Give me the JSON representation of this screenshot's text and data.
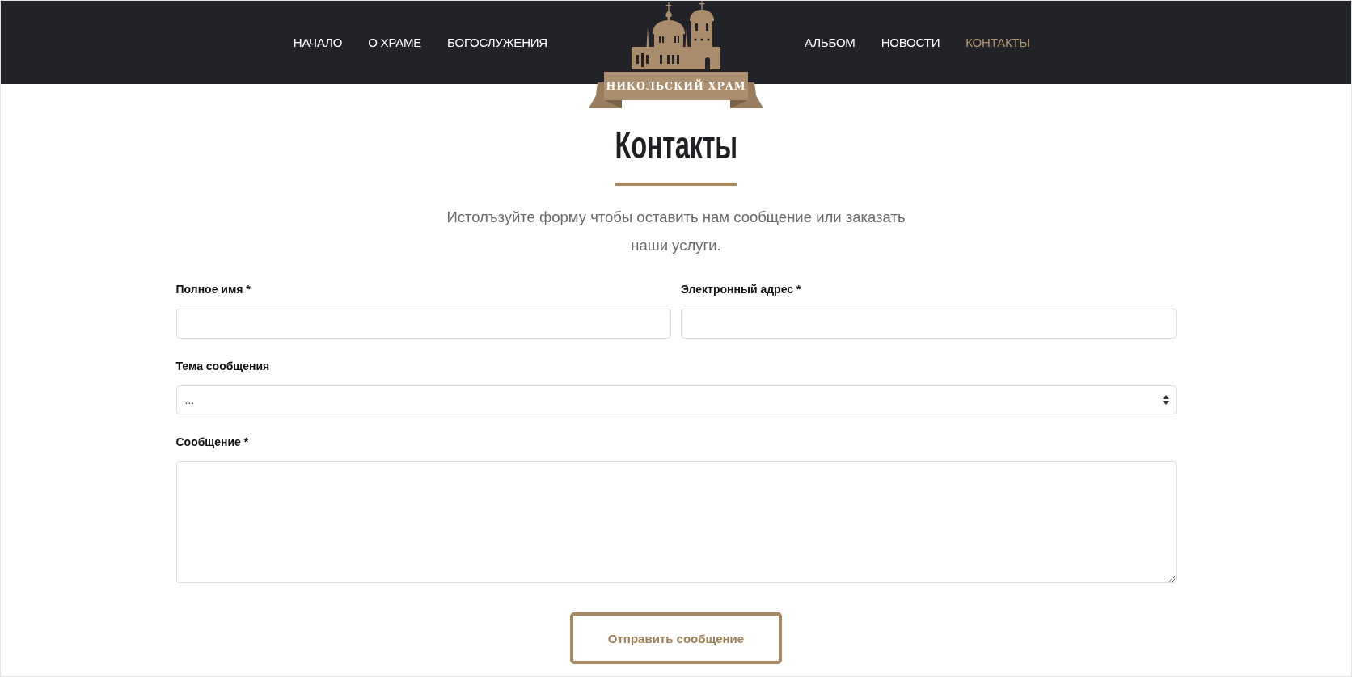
{
  "header": {
    "nav_left": [
      {
        "label": "НАЧАЛО",
        "selected": false
      },
      {
        "label": "О ХРАМЕ",
        "selected": false
      },
      {
        "label": "БОГОСЛУЖЕНИЯ",
        "selected": false
      }
    ],
    "logo": {
      "text": "НИКОЛЬСКИЙ ХРАМ"
    },
    "nav_right": [
      {
        "label": "АЛЬБОМ",
        "selected": false
      },
      {
        "label": "НОВОСТИ",
        "selected": false
      },
      {
        "label": "КОНТАКТЫ",
        "selected": true
      }
    ]
  },
  "page": {
    "title": "Контакты",
    "intro": "Истолъзуйте форму чтобы оставить нам сообщение или заказать наши услуги."
  },
  "form": {
    "fields": [
      {
        "kind": "input",
        "label": "Полное имя *"
      },
      {
        "kind": "input",
        "label": "Электронный адрес *"
      },
      {
        "kind": "select",
        "label": "Тема сообщения",
        "value": "..."
      },
      {
        "kind": "textarea",
        "label": "Сообщение *"
      }
    ],
    "submit": "Отправить сообщение"
  }
}
